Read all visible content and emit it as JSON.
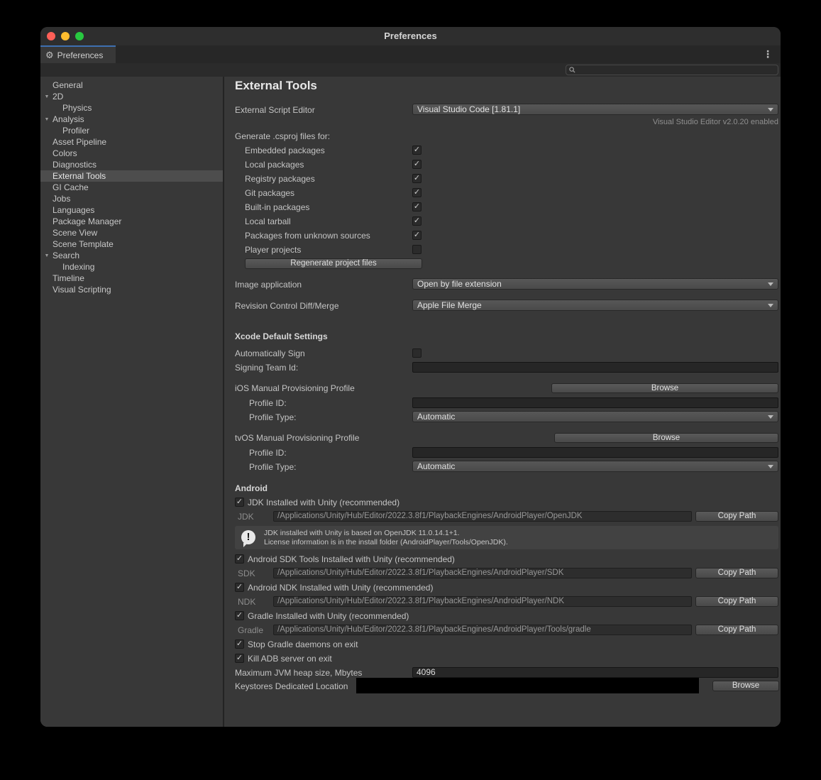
{
  "icons": {
    "gear": "⚙",
    "kebab": "⋮",
    "triangle_down": "▼",
    "exclaim": "!"
  },
  "window": {
    "title": "Preferences"
  },
  "tab": {
    "label": "Preferences"
  },
  "sidebar": {
    "items": [
      {
        "label": "General"
      },
      {
        "label": "2D"
      },
      {
        "label": "Physics"
      },
      {
        "label": "Analysis"
      },
      {
        "label": "Profiler"
      },
      {
        "label": "Asset Pipeline"
      },
      {
        "label": "Colors"
      },
      {
        "label": "Diagnostics"
      },
      {
        "label": "External Tools"
      },
      {
        "label": "GI Cache"
      },
      {
        "label": "Jobs"
      },
      {
        "label": "Languages"
      },
      {
        "label": "Package Manager"
      },
      {
        "label": "Scene View"
      },
      {
        "label": "Scene Template"
      },
      {
        "label": "Search"
      },
      {
        "label": "Indexing"
      },
      {
        "label": "Timeline"
      },
      {
        "label": "Visual Scripting"
      }
    ]
  },
  "main": {
    "title": "External Tools",
    "script_editor": {
      "label": "External Script Editor",
      "value": "Visual Studio Code [1.81.1]",
      "note": "Visual Studio Editor v2.0.20 enabled"
    },
    "csproj": {
      "label": "Generate .csproj files for:",
      "button": "Regenerate project files",
      "items": [
        {
          "label": "Embedded packages",
          "check": "✓"
        },
        {
          "label": "Local packages",
          "check": "✓"
        },
        {
          "label": "Registry packages",
          "check": "✓"
        },
        {
          "label": "Git packages",
          "check": "✓"
        },
        {
          "label": "Built-in packages",
          "check": "✓"
        },
        {
          "label": "Local tarball",
          "check": "✓"
        },
        {
          "label": "Packages from unknown sources",
          "check": "✓"
        },
        {
          "label": "Player projects",
          "check": ""
        }
      ]
    },
    "image_app": {
      "label": "Image application",
      "value": "Open by file extension"
    },
    "revision": {
      "label": "Revision Control Diff/Merge",
      "value": "Apple File Merge"
    },
    "xcode": {
      "title": "Xcode Default Settings",
      "auto_sign": {
        "label": "Automatically Sign",
        "check": ""
      },
      "team_id_label": "Signing Team Id:",
      "ios_label": "iOS Manual Provisioning Profile",
      "tvos_label": "tvOS Manual Provisioning Profile",
      "profile_id_label": "Profile ID:",
      "profile_type_label": "Profile Type:",
      "profile_type_value": "Automatic",
      "browse": "Browse"
    },
    "android": {
      "title": "Android",
      "copy": "Copy Path",
      "browse": "Browse",
      "jdk": {
        "label": "JDK Installed with Unity (recommended)",
        "check": "✓",
        "path_label": "JDK",
        "path": "/Applications/Unity/Hub/Editor/2022.3.8f1/PlaybackEngines/AndroidPlayer/OpenJDK"
      },
      "info": {
        "line1": "JDK installed with Unity is based on OpenJDK 11.0.14.1+1.",
        "line2": "License information is in the install folder (AndroidPlayer/Tools/OpenJDK)."
      },
      "sdk": {
        "label": "Android SDK Tools Installed with Unity (recommended)",
        "check": "✓",
        "path_label": "SDK",
        "path": "/Applications/Unity/Hub/Editor/2022.3.8f1/PlaybackEngines/AndroidPlayer/SDK"
      },
      "ndk": {
        "label": "Android NDK Installed with Unity (recommended)",
        "check": "✓",
        "path_label": "NDK",
        "path": "/Applications/Unity/Hub/Editor/2022.3.8f1/PlaybackEngines/AndroidPlayer/NDK"
      },
      "gradle": {
        "label": "Gradle Installed with Unity (recommended)",
        "check": "✓",
        "path_label": "Gradle",
        "path": "/Applications/Unity/Hub/Editor/2022.3.8f1/PlaybackEngines/AndroidPlayer/Tools/gradle"
      },
      "stop_gradle": {
        "label": "Stop Gradle daemons on exit",
        "check": "✓"
      },
      "kill_adb": {
        "label": "Kill ADB server on exit",
        "check": "✓"
      },
      "heap": {
        "label": "Maximum JVM heap size, Mbytes",
        "value": "4096"
      },
      "keystore": {
        "label": "Keystores Dedicated Location"
      }
    }
  }
}
